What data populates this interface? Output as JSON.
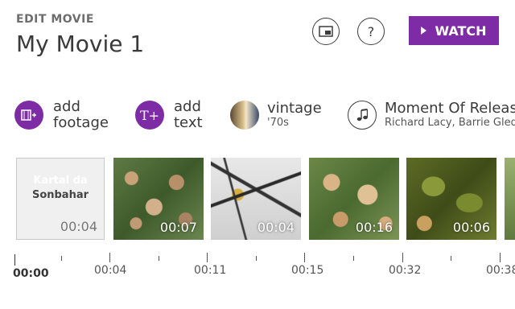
{
  "header": {
    "section_label": "EDIT MOVIE",
    "movie_title": "My Movie 1",
    "watch_label": "WATCH",
    "help_symbol": "?"
  },
  "tools": {
    "add_footage": {
      "line1": "add",
      "line2": "footage",
      "icon": "add-footage-icon"
    },
    "add_text": {
      "line1": "add",
      "line2": "text",
      "icon": "add-text-icon"
    },
    "style": {
      "name": "vintage",
      "sub": "'70s"
    },
    "music": {
      "title": "Moment Of Release",
      "artists": "Richard Lacy, Barrie Gled",
      "icon": "music-note-icon"
    }
  },
  "title_card": {
    "line1": "Kartal da",
    "line2": "Sonbahar",
    "duration": "00:04"
  },
  "clips": [
    {
      "duration": "00:07"
    },
    {
      "duration": "00:04"
    },
    {
      "duration": "00:16"
    },
    {
      "duration": "00:06"
    }
  ],
  "timeline": {
    "labels": [
      "00:00",
      "00:04",
      "00:11",
      "00:15",
      "00:32",
      "00:38"
    ]
  },
  "colors": {
    "accent": "#7d2ca6"
  }
}
